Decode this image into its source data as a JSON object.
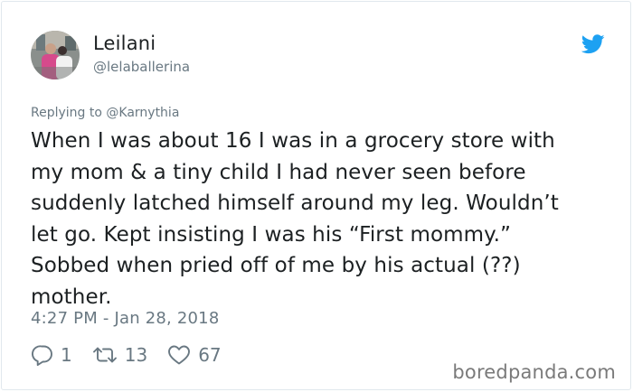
{
  "user": {
    "display_name": "Leilani",
    "handle": "@lelaballerina",
    "avatar_icon": "profile-photo"
  },
  "reply": {
    "prefix": "Replying to ",
    "mention": "@Karnythia"
  },
  "tweet": {
    "text": "When I was about 16 I was in a grocery store with\nmy mom &  a tiny child I had never seen before\nsuddenly latched himself around my leg. Wouldn’t\nlet go. Kept insisting I was his “First mommy.”\nSobbed when pried off of me by his actual (??)\nmother.",
    "timestamp": "4:27 PM - Jan 28, 2018"
  },
  "actions": {
    "reply_count": "1",
    "retweet_count": "13",
    "like_count": "67"
  },
  "icons": {
    "brand": "twitter-bird-icon",
    "reply": "reply-icon",
    "retweet": "retweet-icon",
    "like": "heart-icon"
  },
  "colors": {
    "twitter_blue": "#1da1f2",
    "text": "#1c2022",
    "muted": "#697882"
  },
  "watermark": "boredpanda.com"
}
